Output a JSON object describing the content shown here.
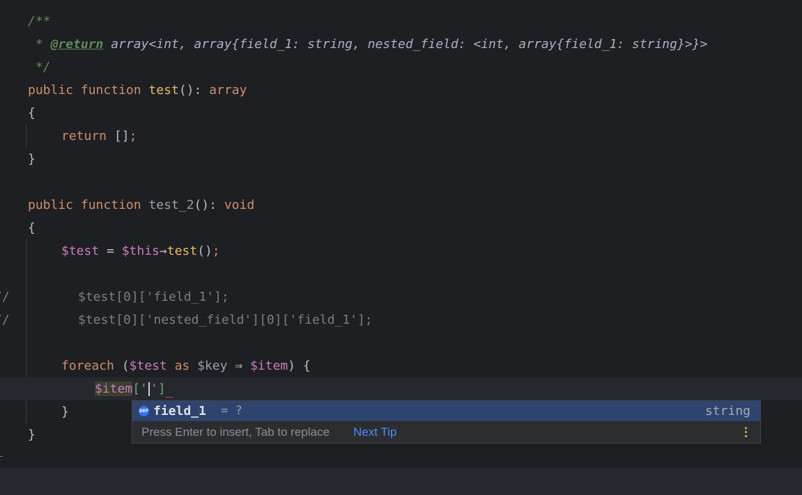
{
  "editor": {
    "doc_open": "/**",
    "doc_star": " * ",
    "doc_tag": "@return",
    "doc_type": " array<int, array{field_1: string, nested_field: <int, array{field_1: string}>}>",
    "doc_close": " */",
    "kw_public": "public",
    "kw_function": "function",
    "fn_test": "test",
    "sig_test": "(): ",
    "ret_array": "array",
    "brace_open": "{",
    "brace_close": "}",
    "kw_return": "return",
    "empty_array": "[]",
    "semi": ";",
    "fn_test_2": "test_2",
    "sig_test_2": "(): ",
    "ret_void": "void",
    "var_test": "$test",
    "assign": " = ",
    "var_this": "$this",
    "arrow": "→",
    "call_test": "test",
    "call_parens": "()",
    "comment_marker": "//",
    "commented_line_1": "$test[0]['field_1'];",
    "commented_line_2": "$test[0]['nested_field'][0]['field_1'];",
    "kw_foreach": "foreach",
    "paren_open": " (",
    "kw_as": " as ",
    "var_key": "$key",
    "double_arrow": " ⇒ ",
    "var_item": "$item",
    "foreach_tail": ") {",
    "current_var": "$item",
    "current_open": "['",
    "current_close": "']",
    "squiggle": "﹏"
  },
  "completion": {
    "icon_text": "DEF",
    "item_name": "field_1",
    "item_tail": " = ?",
    "item_type": "string",
    "hint": "Press Enter to insert, Tab to replace",
    "next_tip": "Next Tip",
    "more_icon": "⋮"
  },
  "colors": {
    "background": "#1e1f22",
    "keyword": "#cf8e6d",
    "function": "#e8b96a",
    "variable": "#c77dbb",
    "doc_comment": "#5f8c5a",
    "string": "#6aab73",
    "popup_selected": "#2e436e",
    "link": "#548af7"
  }
}
